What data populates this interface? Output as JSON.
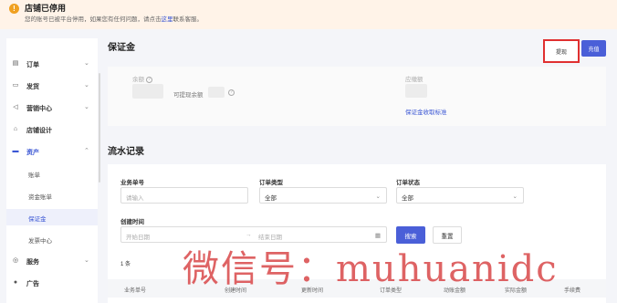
{
  "banner": {
    "title": "店铺已停用",
    "desc_prefix": "您的账号已被平台停用，如果您有任何问题，请点击",
    "desc_link": "这里",
    "desc_suffix": "联系客服。"
  },
  "sidebar": {
    "items": [
      {
        "label": "订单",
        "icon": "order-icon",
        "chevron": "⌄"
      },
      {
        "label": "发货",
        "icon": "ship-icon",
        "chevron": "⌄"
      },
      {
        "label": "营销中心",
        "icon": "marketing-icon",
        "chevron": "⌄"
      },
      {
        "label": "店铺设计",
        "icon": "design-icon",
        "chevron": ""
      },
      {
        "label": "资产",
        "icon": "asset-icon",
        "chevron": "⌃"
      },
      {
        "label": "账单"
      },
      {
        "label": "资金账单"
      },
      {
        "label": "保证金"
      },
      {
        "label": "发票中心"
      },
      {
        "label": "服务",
        "icon": "service-icon",
        "chevron": "⌄"
      },
      {
        "label": "广告",
        "icon": "ad-icon",
        "chevron": ""
      }
    ]
  },
  "deposit": {
    "title": "保证金",
    "withdraw_label": "提现",
    "recharge_label": "充值",
    "balance_label": "余额",
    "withdrawable_label": "可提现余额",
    "payable_label": "应缴额",
    "standard_link": "保证金收取标准"
  },
  "flow": {
    "title": "流水记录",
    "filters": {
      "biz_no_label": "业务单号",
      "biz_no_placeholder": "请输入",
      "order_type_label": "订单类型",
      "order_type_value": "全部",
      "order_status_label": "订单状态",
      "order_status_value": "全部",
      "create_time_label": "创建时间",
      "start_date_placeholder": "开始日期",
      "date_separator": "→",
      "end_date_placeholder": "结束日期"
    },
    "search_label": "搜索",
    "reset_label": "重置",
    "count_text": "1 条",
    "columns": [
      "业务单号",
      "创建时间",
      "更新时间",
      "订单类型",
      "动账金额",
      "实际金额",
      "手续费"
    ]
  },
  "watermark": "微信号：muhuanidc"
}
